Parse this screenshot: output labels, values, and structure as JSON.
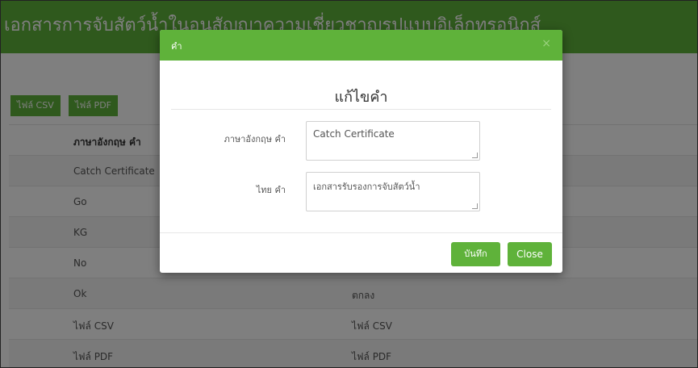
{
  "page": {
    "title": "เอกสารการจับสัตว์น้ำในอนุสัญญาความเชี่ยวชาญรูปแบบอิเล็กทรอนิกส์",
    "export_csv": "ไฟล์ CSV",
    "export_pdf": "ไฟล์ PDF"
  },
  "table": {
    "headers": [
      "ภาษาอังกฤษ คำ",
      ""
    ],
    "rows": [
      [
        "Catch Certificate",
        ""
      ],
      [
        "Go",
        ""
      ],
      [
        "KG",
        ""
      ],
      [
        "No",
        ""
      ],
      [
        "Ok",
        "ตกลง"
      ],
      [
        "ไฟล์ CSV",
        "ไฟล์ CSV"
      ],
      [
        "ไฟล์ PDF",
        "ไฟล์ PDF"
      ]
    ]
  },
  "modal": {
    "header_label": "คำ",
    "close_icon": "×",
    "title": "แก้ไขคำ",
    "english_label": "ภาษาอังกฤษ คำ",
    "english_value": "Catch Certificate",
    "thai_label": "ไทย คำ",
    "thai_value": "เอกสารรับรองการจับสัตว์น้ำ",
    "save_label": "บันทึก",
    "close_label": "Close"
  },
  "colors": {
    "accent": "#5fb23a",
    "backdrop": "rgba(0,0,0,0.5)"
  }
}
